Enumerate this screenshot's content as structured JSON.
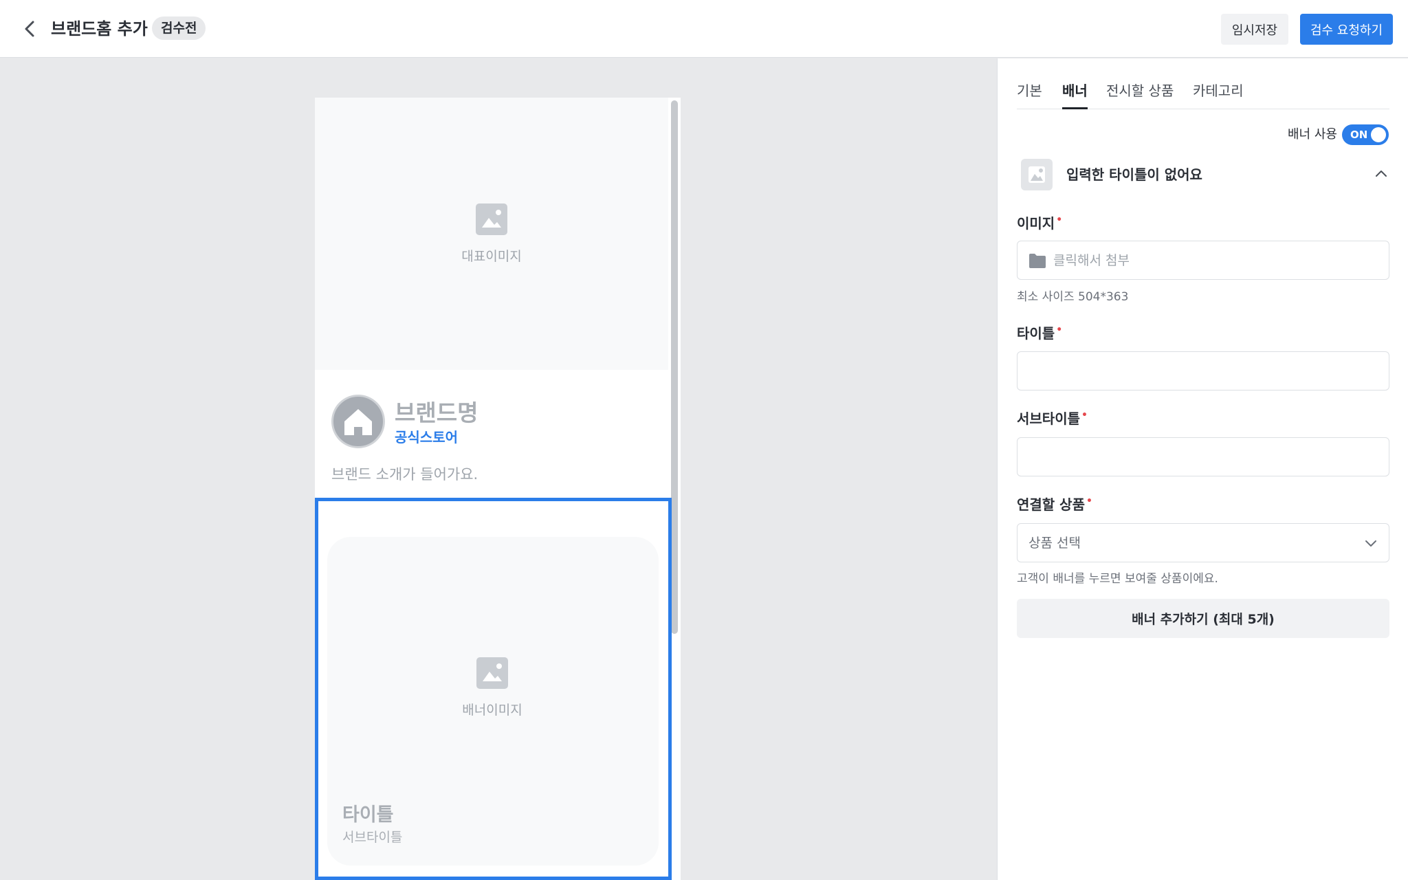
{
  "header": {
    "title": "브랜드홈 추가",
    "status_badge": "검수전",
    "temp_save_label": "임시저장",
    "request_review_label": "검수 요청하기"
  },
  "preview": {
    "hero_placeholder": "대표이미지",
    "brand_name": "브랜드명",
    "brand_sub": "공식스토어",
    "brand_intro": "브랜드 소개가 들어가요.",
    "banner_placeholder": "배너이미지",
    "banner_title": "타이틀",
    "banner_subtitle": "서브타이틀"
  },
  "panel": {
    "tabs": [
      {
        "label": "기본",
        "active": false
      },
      {
        "label": "배너",
        "active": true
      },
      {
        "label": "전시할 상품",
        "active": false
      },
      {
        "label": "카테고리",
        "active": false
      }
    ],
    "toggle_label": "배너 사용",
    "toggle_state": "ON",
    "accordion_title": "입력한 타이틀이 없어요",
    "image_label": "이미지",
    "image_placeholder": "클릭해서 첨부",
    "image_hint": "최소 사이즈 504*363",
    "title_label": "타이틀",
    "title_value": "",
    "subtitle_label": "서브타이틀",
    "subtitle_value": "",
    "product_label": "연결할 상품",
    "product_placeholder": "상품 선택",
    "product_hint": "고객이 배너를 누르면 보여줄 상품이에요.",
    "add_banner_label": "배너 추가하기 (최대 5개)"
  },
  "colors": {
    "accent": "#2b7de9",
    "required": "#e5484d",
    "canvas_bg": "#e8e9eb"
  }
}
